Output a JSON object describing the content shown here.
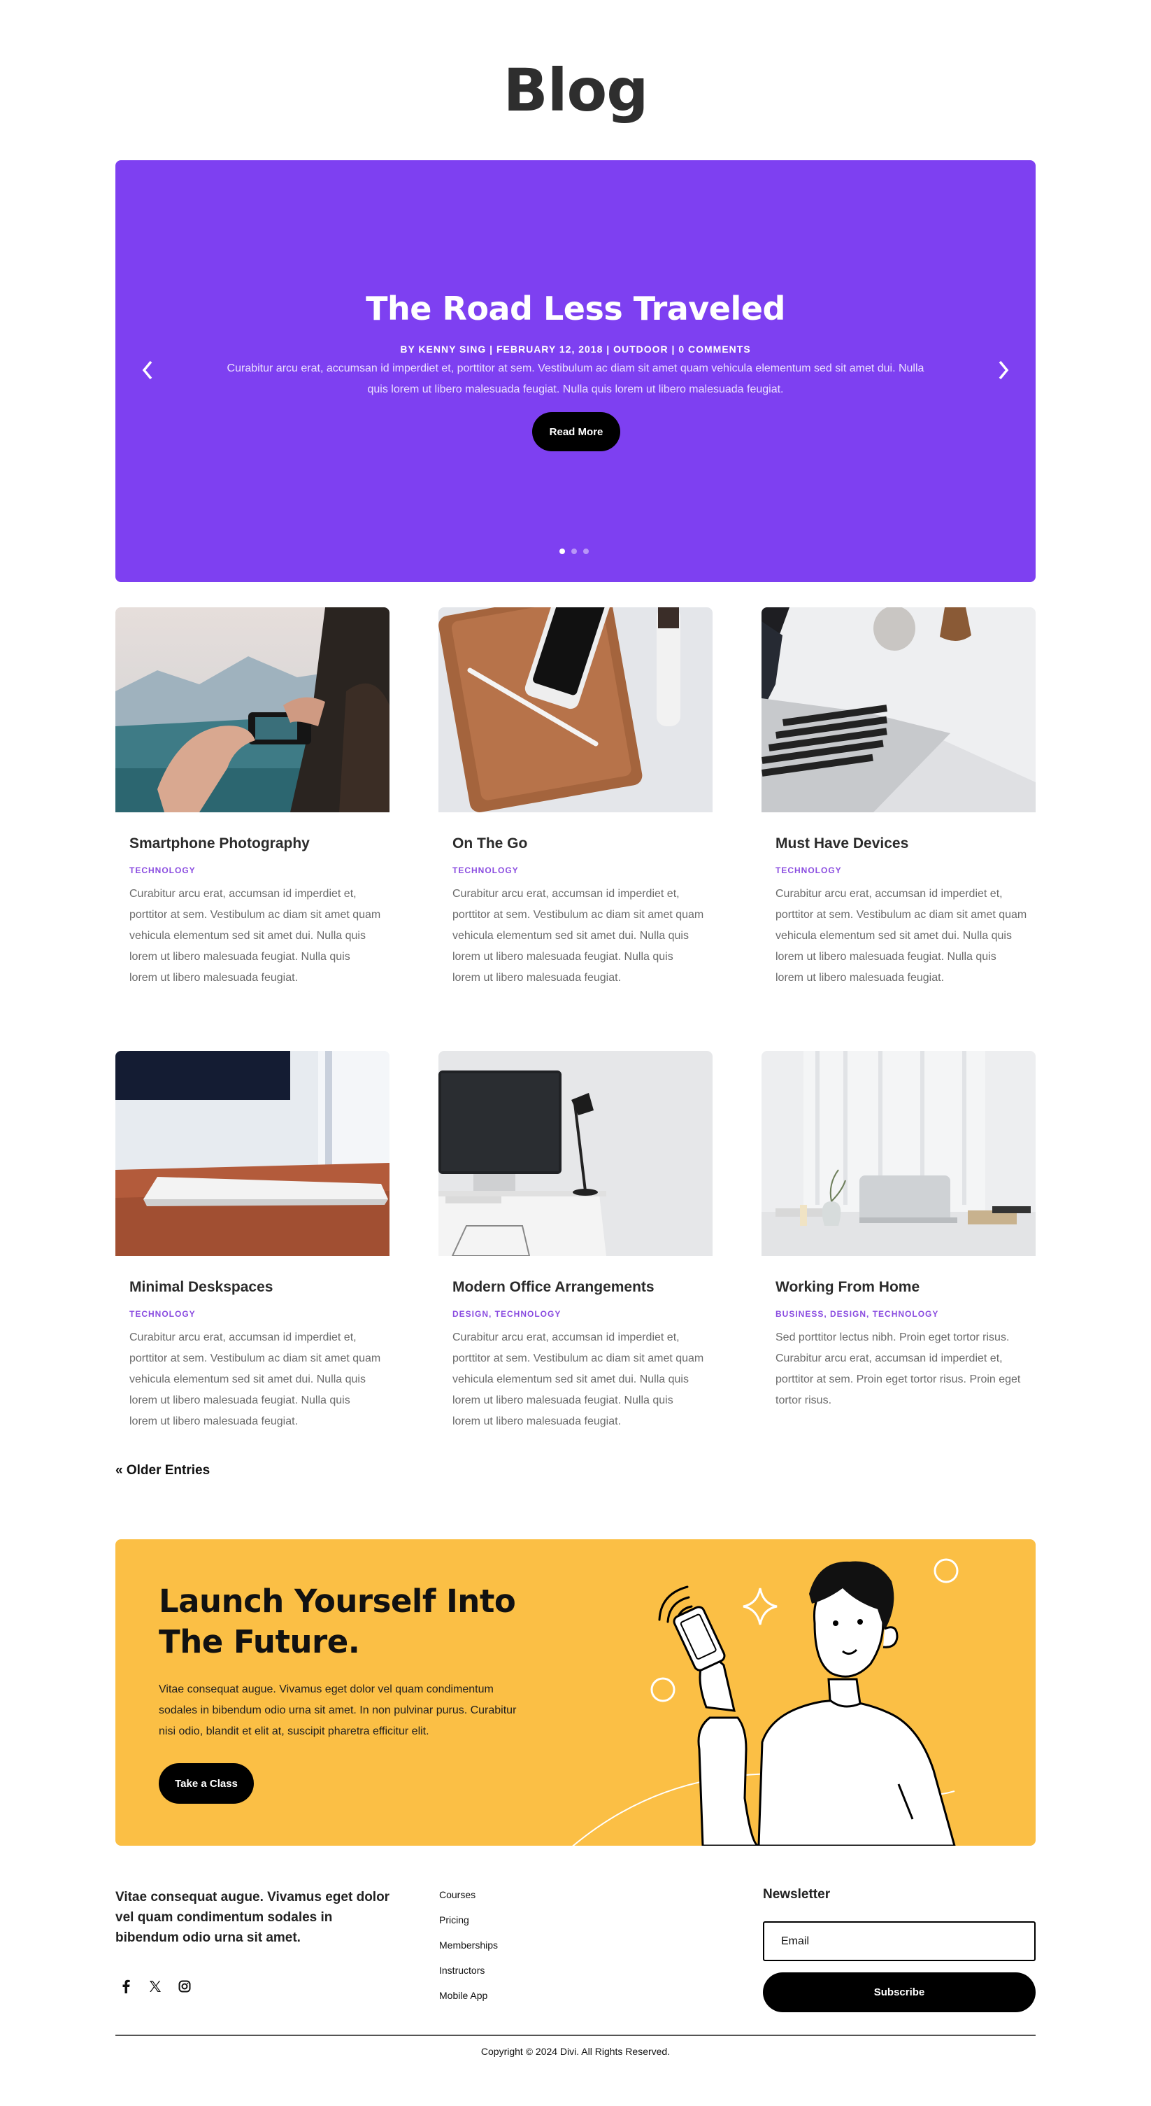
{
  "page": {
    "title": "Blog"
  },
  "slider": {
    "title": "The Road Less Traveled",
    "meta": "BY KENNY SING | FEBRUARY 12, 2018 | OUTDOOR | 0 COMMENTS",
    "excerpt": "Curabitur arcu erat, accumsan id imperdiet et, porttitor at sem. Vestibulum ac diam sit amet quam vehicula elementum sed sit amet dui. Nulla quis lorem ut libero malesuada feugiat. Nulla quis lorem ut libero malesuada feugiat.",
    "button_label": "Read More",
    "slide_count": 3,
    "active_slide": 1,
    "background_color": "#7e40f1"
  },
  "posts": [
    {
      "title": "Smartphone Photography",
      "categories": "TECHNOLOGY",
      "excerpt": "Curabitur arcu erat, accumsan id imperdiet et, porttitor at sem. Vestibulum ac diam sit amet quam vehicula elementum sed sit amet dui. Nulla quis lorem ut libero malesuada feugiat. Nulla quis lorem ut libero malesuada feugiat."
    },
    {
      "title": "On The Go",
      "categories": "TECHNOLOGY",
      "excerpt": "Curabitur arcu erat, accumsan id imperdiet et, porttitor at sem. Vestibulum ac diam sit amet quam vehicula elementum sed sit amet dui. Nulla quis lorem ut libero malesuada feugiat. Nulla quis lorem ut libero malesuada feugiat."
    },
    {
      "title": "Must Have Devices",
      "categories": "TECHNOLOGY",
      "excerpt": "Curabitur arcu erat, accumsan id imperdiet et, porttitor at sem. Vestibulum ac diam sit amet quam vehicula elementum sed sit amet dui. Nulla quis lorem ut libero malesuada feugiat. Nulla quis lorem ut libero malesuada feugiat."
    },
    {
      "title": "Minimal Deskspaces",
      "categories": "TECHNOLOGY",
      "excerpt": "Curabitur arcu erat, accumsan id imperdiet et, porttitor at sem. Vestibulum ac diam sit amet quam vehicula elementum sed sit amet dui. Nulla quis lorem ut libero malesuada feugiat. Nulla quis lorem ut libero malesuada feugiat."
    },
    {
      "title": "Modern Office Arrangements",
      "categories": "DESIGN, TECHNOLOGY",
      "excerpt": "Curabitur arcu erat, accumsan id imperdiet et, porttitor at sem. Vestibulum ac diam sit amet quam vehicula elementum sed sit amet dui. Nulla quis lorem ut libero malesuada feugiat. Nulla quis lorem ut libero malesuada feugiat."
    },
    {
      "title": "Working From Home",
      "categories": "BUSINESS, DESIGN, TECHNOLOGY",
      "excerpt": "Sed porttitor lectus nibh. Proin eget tortor risus. Curabitur arcu erat, accumsan id imperdiet et, porttitor at sem. Proin eget tortor risus. Proin eget tortor risus."
    }
  ],
  "pagination": {
    "older_label": "« Older Entries"
  },
  "cta": {
    "title": "Launch Yourself Into The Future.",
    "text": "Vitae consequat augue. Vivamus eget dolor vel quam condimentum sodales in bibendum odio urna sit amet. In non pulvinar purus. Curabitur nisi odio, blandit et elit at, suscipit pharetra efficitur elit.",
    "button_label": "Take a Class",
    "background_color": "#fbbf45"
  },
  "footer": {
    "tagline": "Vitae consequat augue. Vivamus eget dolor vel quam condimentum sodales in bibendum odio urna sit amet.",
    "links": [
      "Courses",
      "Pricing",
      "Memberships",
      "Instructors",
      "Mobile App"
    ],
    "social_icons": [
      "facebook-icon",
      "x-icon",
      "instagram-icon"
    ],
    "newsletter": {
      "heading": "Newsletter",
      "email_placeholder": "Email",
      "button_label": "Subscribe"
    },
    "copyright": "Copyright © 2024 Divi. All Rights Reserved."
  },
  "colors": {
    "accent": "#8a4ce0",
    "text": "#2b2b2b",
    "muted_text": "#6b6b6b"
  }
}
